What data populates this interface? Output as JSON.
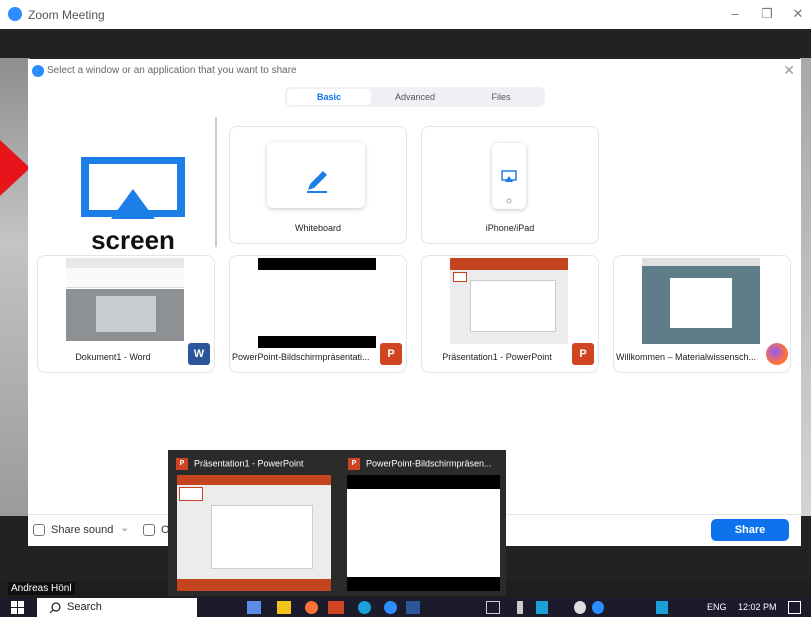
{
  "window": {
    "title": "Zoom Meeting",
    "minimize": "–",
    "restore": "❐",
    "close": "✕"
  },
  "dialog": {
    "title": "Select a window or an application that you want to share",
    "close": "✕",
    "tabs": [
      "Basic",
      "Advanced",
      "Files"
    ],
    "active_tab": "Basic",
    "screen_option": {
      "label": "screen"
    },
    "options": [
      {
        "label": "Whiteboard"
      },
      {
        "label": "iPhone/iPad"
      }
    ],
    "windows": [
      {
        "label": "Dokument1 - Word",
        "app": "W"
      },
      {
        "label": "PowerPoint-Bildschirmpräsentati...",
        "app": "P"
      },
      {
        "label": "Präsentation1 - PowerPoint",
        "app": "P"
      },
      {
        "label": "Willkommen – Materialwissensch...",
        "app": "firefox"
      }
    ],
    "footer": {
      "share_sound": "Share sound",
      "chevron": "⌄",
      "optimize_prefix": "O",
      "share_button": "Share"
    }
  },
  "participant": {
    "name": "Andreas Hönl"
  },
  "preview": {
    "items": [
      {
        "label": "Präsentation1 - PowerPoint",
        "badge": "P"
      },
      {
        "label": "PowerPoint-Bildschirmpräsen...",
        "badge": "P"
      }
    ]
  },
  "taskbar": {
    "search_label": "Search",
    "language": "ENG",
    "time": "12:02 PM"
  },
  "colors": {
    "accent": "#0e72ed",
    "zoom_blue": "#2d8cff",
    "powerpoint": "#d04423",
    "word": "#2b579a",
    "firefox": "#ff7139",
    "red_marker": "#e8141c"
  }
}
